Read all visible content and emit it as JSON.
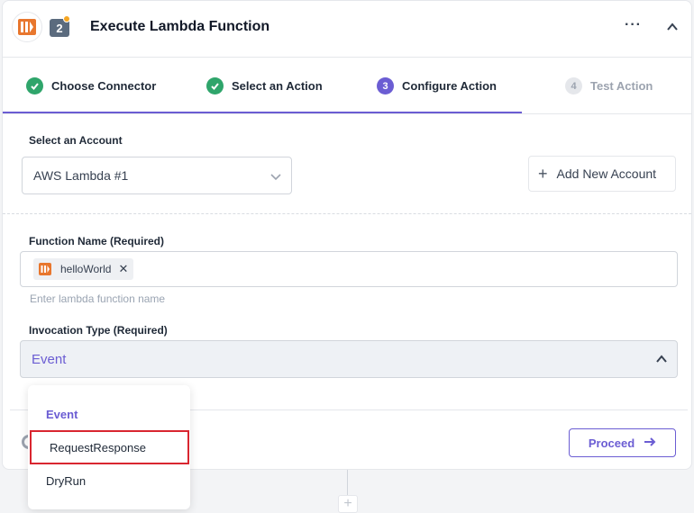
{
  "header": {
    "title": "Execute Lambda Function",
    "step_number": "2",
    "more_label": "···"
  },
  "tabs": [
    {
      "label": "Choose Connector",
      "state": "done",
      "icon": "check-icon"
    },
    {
      "label": "Select an Action",
      "state": "done",
      "icon": "check-icon"
    },
    {
      "label": "Configure Action",
      "state": "active",
      "number": "3"
    },
    {
      "label": "Test Action",
      "state": "pending",
      "number": "4"
    }
  ],
  "account": {
    "label": "Select an Account",
    "value": "AWS Lambda #1",
    "add_button": "Add New Account"
  },
  "function_name": {
    "label": "Function Name (Required)",
    "chip": "helloWorld",
    "hint": "Enter lambda function name"
  },
  "invocation": {
    "label": "Invocation Type (Required)",
    "value": "Event",
    "options": [
      "Event",
      "RequestResponse",
      "DryRun"
    ]
  },
  "footer": {
    "proceed_label": "Proceed"
  },
  "colors": {
    "accent": "#6b5dd3",
    "success": "#2fa56b",
    "highlight": "#d92630",
    "aws_orange": "#e8772e"
  }
}
